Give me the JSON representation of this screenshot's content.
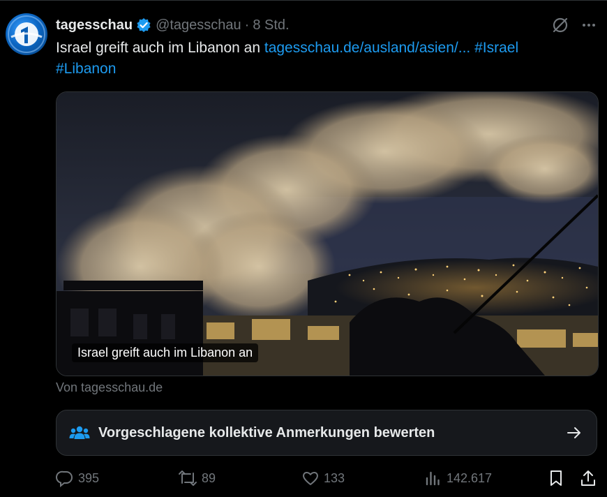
{
  "tweet": {
    "author_name": "tagesschau",
    "handle": "@tagesschau",
    "separator": "·",
    "time": "8 Std.",
    "text_plain": "Israel greift auch im Libanon an",
    "link_text": "tagesschau.de/ausland/asien/...",
    "hashtag_1": "#Israel",
    "hashtag_2": "#Libanon"
  },
  "card": {
    "title": "Israel greift auch im Libanon an",
    "source": "Von tagesschau.de"
  },
  "community_notes": {
    "label": "Vorgeschlagene kollektive Anmerkungen bewerten"
  },
  "actions": {
    "replies": "395",
    "reposts": "89",
    "likes": "133",
    "views": "142.617"
  },
  "colors": {
    "background": "#000000",
    "text": "#e7e9ea",
    "secondary": "#71767b",
    "link": "#1d9bf0",
    "border": "#2f3336"
  },
  "icons": [
    "verified-badge-icon",
    "grok-icon",
    "more-icon",
    "community-notes-icon",
    "arrow-right-icon",
    "reply-icon",
    "repost-icon",
    "like-icon",
    "views-icon",
    "bookmark-icon",
    "share-icon"
  ]
}
